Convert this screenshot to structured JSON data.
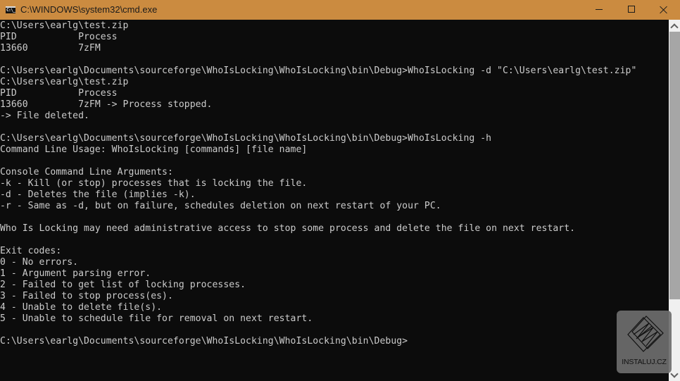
{
  "window": {
    "title": "C:\\WINDOWS\\system32\\cmd.exe",
    "app_icon_label": "C:\\_",
    "controls": {
      "minimize": "minimize",
      "maximize": "maximize",
      "close": "close"
    },
    "titlebar_color": "#cb8b40"
  },
  "console": {
    "lines": [
      "C:\\Users\\earlg\\test.zip",
      "PID           Process",
      "13660         7zFM",
      "",
      "C:\\Users\\earlg\\Documents\\sourceforge\\WhoIsLocking\\WhoIsLocking\\bin\\Debug>WhoIsLocking -d \"C:\\Users\\earlg\\test.zip\"",
      "C:\\Users\\earlg\\test.zip",
      "PID           Process",
      "13660         7zFM -> Process stopped.",
      "-> File deleted.",
      "",
      "C:\\Users\\earlg\\Documents\\sourceforge\\WhoIsLocking\\WhoIsLocking\\bin\\Debug>WhoIsLocking -h",
      "Command Line Usage: WhoIsLocking [commands] [file name]",
      "",
      "Console Command Line Arguments:",
      "-k - Kill (or stop) processes that is locking the file.",
      "-d - Deletes the file (implies -k).",
      "-r - Same as -d, but on failure, schedules deletion on next restart of your PC.",
      "",
      "Who Is Locking may need administrative access to stop some process and delete the file on next restart.",
      "",
      "Exit codes:",
      "0 - No errors.",
      "1 - Argument parsing error.",
      "2 - Failed to get list of locking processes.",
      "3 - Failed to stop process(es).",
      "4 - Unable to delete file(s).",
      "5 - Unable to schedule file for removal on next restart.",
      "",
      "C:\\Users\\earlg\\Documents\\sourceforge\\WhoIsLocking\\WhoIsLocking\\bin\\Debug>"
    ]
  },
  "scrollbar": {
    "up_icon": "chevron-up-icon",
    "down_icon": "chevron-down-icon"
  },
  "watermark": {
    "text": "INSTALUJ.CZ"
  }
}
